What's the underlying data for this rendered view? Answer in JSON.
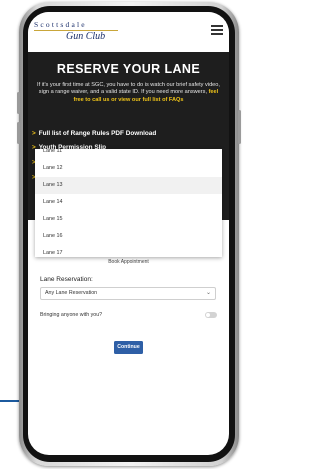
{
  "site": {
    "logo_top": "Scottsdale",
    "logo_bottom": "Gun Club"
  },
  "hero": {
    "title": "RESERVE YOUR LANE",
    "intro": "If it's your first time at SGC, you have to do is watch our brief safety video, sign a range waiver, and a valid state ID. If you need more answers,",
    "highlight": "feel free to call us or view our full list of FAQs",
    "links": [
      "Full list of Range Rules PDF Download",
      "Youth Permission Slip"
    ]
  },
  "dropdown": {
    "items": [
      "Lane 11",
      "Lane 12",
      "Lane 13",
      "Lane 14",
      "Lane 15",
      "Lane 16",
      "Lane 17"
    ],
    "highlighted_index": 2
  },
  "form": {
    "book_label": "Book Appointment",
    "lane_label": "Lane Reservation:",
    "lane_value": "Any Lane Reservation",
    "bring_label": "Bringing anyone with you?",
    "bring_toggle_on": false,
    "continue_label": "Continue"
  },
  "colors": {
    "hero_bg": "#1e1e1e",
    "accent_yellow": "#f0c419",
    "button_blue": "#2e5fa6",
    "logo_navy": "#1b2f6b"
  },
  "icons": [
    "hamburger-menu-icon",
    "chevron-right-icon",
    "dropdown-caret-icon"
  ]
}
